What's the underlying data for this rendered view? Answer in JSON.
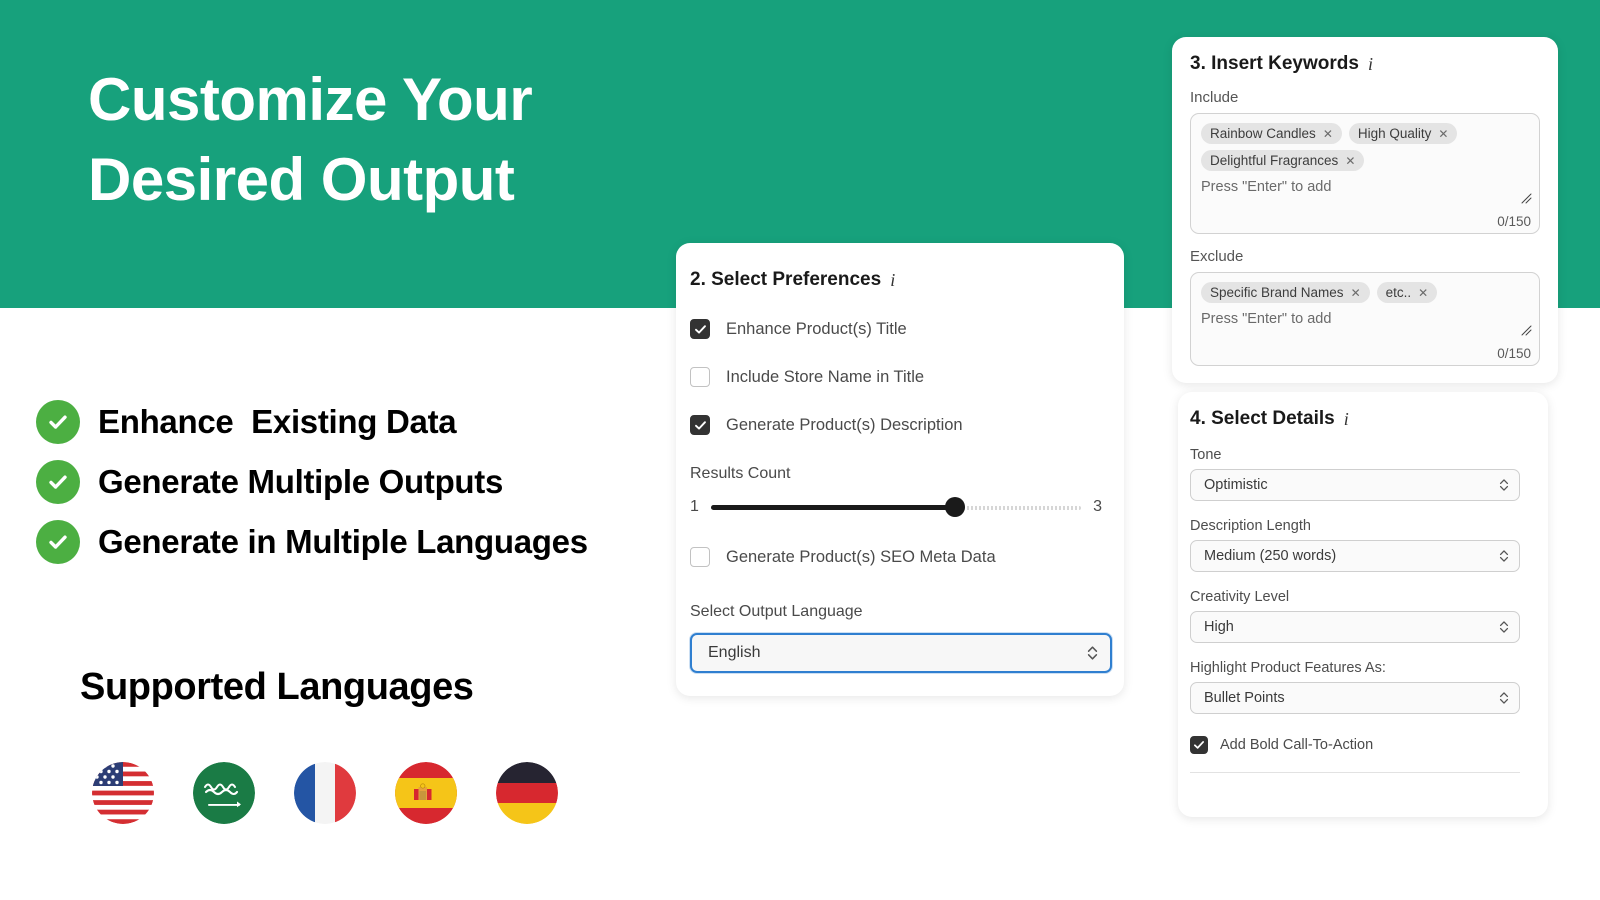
{
  "theme": {
    "brand_green": "#17a17c",
    "check_green": "#4caf42",
    "focus_blue": "#2f7fd0",
    "checkbox_dark": "#333333"
  },
  "hero": {
    "title_line1": "Customize Your",
    "title_line2": "Desired Output"
  },
  "features": [
    {
      "label": "Enhance  Existing Data",
      "icon": "check-circle-icon"
    },
    {
      "label": "Generate Multiple Outputs",
      "icon": "check-circle-icon"
    },
    {
      "label": "Generate in Multiple Languages",
      "icon": "check-circle-icon"
    }
  ],
  "languages": {
    "heading": "Supported Languages",
    "flags": [
      {
        "name": "flag-united-states-icon",
        "country": "United States"
      },
      {
        "name": "flag-saudi-arabia-icon",
        "country": "Saudi Arabia"
      },
      {
        "name": "flag-france-icon",
        "country": "France"
      },
      {
        "name": "flag-spain-icon",
        "country": "Spain"
      },
      {
        "name": "flag-germany-icon",
        "country": "Germany"
      }
    ]
  },
  "preferences_card": {
    "title": "2. Select Preferences",
    "info_icon": "i",
    "checkboxes": [
      {
        "label": "Enhance Product(s) Title",
        "checked": true
      },
      {
        "label": "Include Store Name in Title",
        "checked": false
      },
      {
        "label": "Generate Product(s) Description",
        "checked": true
      }
    ],
    "slider": {
      "label": "Results Count",
      "min_label": "1",
      "max_label": "3",
      "min": 1,
      "max": 3,
      "value": 2,
      "fill_percent": 66
    },
    "seo_checkbox": {
      "label": "Generate Product(s) SEO Meta Data",
      "checked": false
    },
    "language_select": {
      "label": "Select Output Language",
      "value": "English",
      "focused": true
    }
  },
  "keywords_card": {
    "title": "3. Insert Keywords",
    "info_icon": "i",
    "include": {
      "label": "Include",
      "tags": [
        "Rainbow Candles",
        "High Quality",
        "Delightful Fragrances"
      ],
      "placeholder": "Press \"Enter\" to add",
      "char_count": "0/150"
    },
    "exclude": {
      "label": "Exclude",
      "tags": [
        "Specific Brand Names",
        "etc.."
      ],
      "placeholder": "Press \"Enter\" to add",
      "char_count": "0/150"
    }
  },
  "details_card": {
    "title": "4. Select Details",
    "info_icon": "i",
    "selects": [
      {
        "label": "Tone",
        "value": "Optimistic"
      },
      {
        "label": "Description Length",
        "value": "Medium (250 words)"
      },
      {
        "label": "Creativity Level",
        "value": "High"
      },
      {
        "label": "Highlight Product Features As:",
        "value": "Bullet Points"
      }
    ],
    "cta_checkbox": {
      "label": "Add Bold Call-To-Action",
      "checked": true
    }
  }
}
